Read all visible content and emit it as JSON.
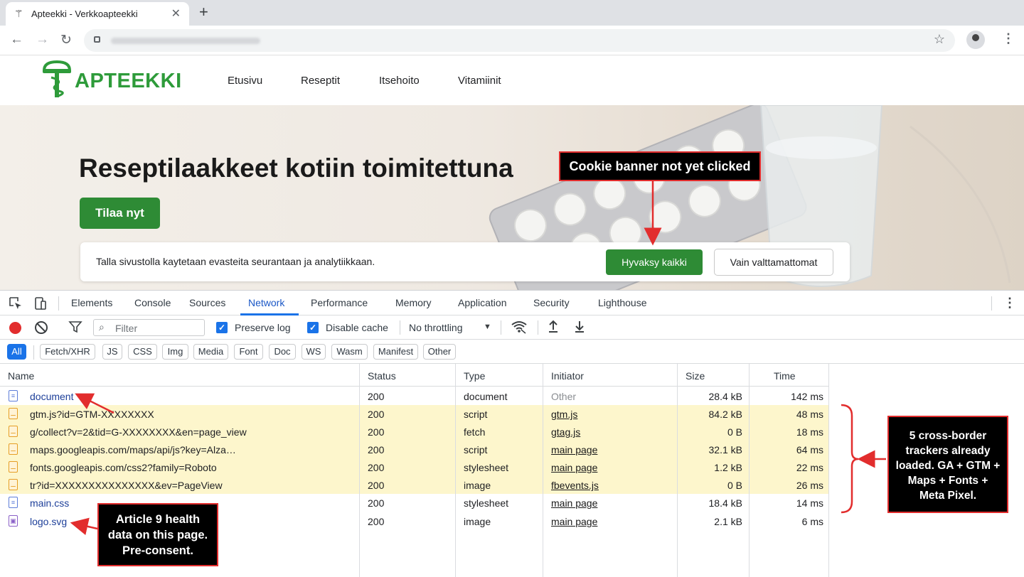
{
  "browser": {
    "tab_title": "Apteekki - Verkkoapteekki",
    "tab_favicon": "⚚",
    "close_glyph": "✕",
    "newtab_glyph": "+",
    "back_glyph": "←",
    "forward_glyph": "→",
    "reload_glyph": "↻",
    "star_glyph": "☆",
    "menu_glyph": "⋮"
  },
  "site": {
    "logo_text": "APTEEKKI",
    "nav": [
      "Etusivu",
      "Reseptit",
      "Itsehoito",
      "Vitamiinit"
    ],
    "hero_title": "Reseptilaakkeet kotiin toimitettuna",
    "cta_label": "Tilaa nyt",
    "cookie": {
      "message": "Talla sivustolla kaytetaan evasteita seurantaan ja analytiikkaan.",
      "accept_label": "Hyvaksy kaikki",
      "necessary_label": "Vain valttamattomat"
    }
  },
  "devtools": {
    "tabs": [
      "Elements",
      "Console",
      "Sources",
      "Network",
      "Performance",
      "Memory",
      "Application",
      "Security",
      "Lighthouse"
    ],
    "active_tab": "Network",
    "filter_placeholder": "Filter",
    "preserve_log": "Preserve log",
    "disable_cache": "Disable cache",
    "throttling": "No throttling",
    "type_filters": [
      "All",
      "Fetch/XHR",
      "JS",
      "CSS",
      "Img",
      "Media",
      "Font",
      "Doc",
      "WS",
      "Wasm",
      "Manifest",
      "Other"
    ],
    "columns": [
      "Name",
      "Status",
      "Type",
      "Initiator",
      "Size",
      "Time"
    ],
    "rows": [
      {
        "name": "document",
        "status": "200",
        "type": "document",
        "initiator": "Other",
        "size": "28.4 kB",
        "time": "142 ms",
        "icon": "doc",
        "highlight": false
      },
      {
        "name": "gtm.js?id=GTM-XXXXXXXX",
        "status": "200",
        "type": "script",
        "initiator": "gtm.js",
        "size": "84.2 kB",
        "time": "48 ms",
        "icon": "js",
        "highlight": true
      },
      {
        "name": "g/collect?v=2&tid=G-XXXXXXXX&en=page_view",
        "status": "200",
        "type": "fetch",
        "initiator": "gtag.js",
        "size": "0 B",
        "time": "18 ms",
        "icon": "js",
        "highlight": true
      },
      {
        "name": "maps.googleapis.com/maps/api/js?key=Alza…",
        "status": "200",
        "type": "script",
        "initiator": "main page",
        "size": "32.1 kB",
        "time": "64 ms",
        "icon": "js",
        "highlight": true
      },
      {
        "name": "fonts.googleapis.com/css2?family=Roboto",
        "status": "200",
        "type": "stylesheet",
        "initiator": "main page",
        "size": "1.2 kB",
        "time": "22 ms",
        "icon": "js",
        "highlight": true
      },
      {
        "name": "tr?id=XXXXXXXXXXXXXXX&ev=PageView",
        "status": "200",
        "type": "image",
        "initiator": "fbevents.js",
        "size": "0 B",
        "time": "26 ms",
        "icon": "js",
        "highlight": true
      },
      {
        "name": "main.css",
        "status": "200",
        "type": "stylesheet",
        "initiator": "main page",
        "size": "18.4 kB",
        "time": "14 ms",
        "icon": "doc",
        "highlight": false
      },
      {
        "name": "logo.svg",
        "status": "200",
        "type": "image",
        "initiator": "main page",
        "size": "2.1 kB",
        "time": "6 ms",
        "icon": "img",
        "highlight": false
      }
    ]
  },
  "annotations": {
    "cookie_banner": "Cookie banner not yet clicked",
    "trackers": "5 cross-border trackers already loaded. GA + GTM + Maps + Fonts + Meta Pixel.",
    "article9": "Article 9 health data on this page. Pre-consent."
  },
  "colors": {
    "brand_green": "#2e8b35",
    "devtools_blue": "#1a73e8",
    "highlight_yellow": "#fdf6cc",
    "annotation_red": "#e22d2d"
  }
}
